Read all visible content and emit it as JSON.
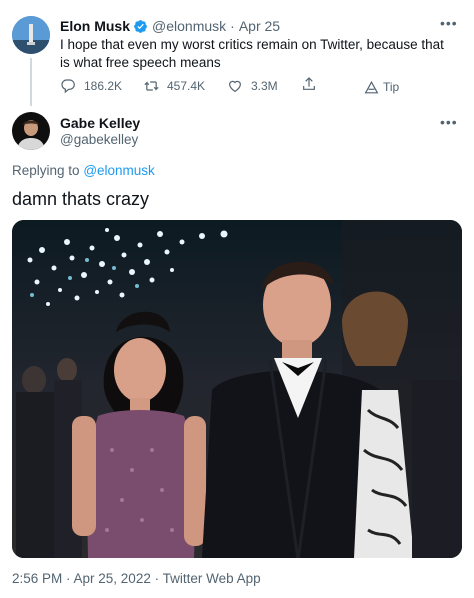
{
  "quoted_tweet": {
    "author_name": "Elon Musk",
    "handle": "@elonmusk",
    "separator": "·",
    "date": "Apr 25",
    "text": "I hope that even my worst critics remain on Twitter, because that is what free speech means",
    "actions": {
      "replies": "186.2K",
      "retweets": "457.4K",
      "likes": "3.3M",
      "tip_label": "Tip"
    }
  },
  "reply_tweet": {
    "author_name": "Gabe Kelley",
    "handle": "@gabekelley",
    "replying_to_prefix": "Replying to",
    "replying_to_handle": "@elonmusk",
    "text": "damn thats crazy",
    "timestamp": "2:56 PM · Apr 25, 2022 · Twitter Web App"
  },
  "colors": {
    "link": "#1d9bf0",
    "verified": "#1d9bf0",
    "text": "#0f1419",
    "muted": "#536471"
  },
  "icons": [
    "more-icon",
    "verified-icon",
    "reply-icon",
    "retweet-icon",
    "like-icon",
    "share-icon",
    "tip-icon"
  ]
}
